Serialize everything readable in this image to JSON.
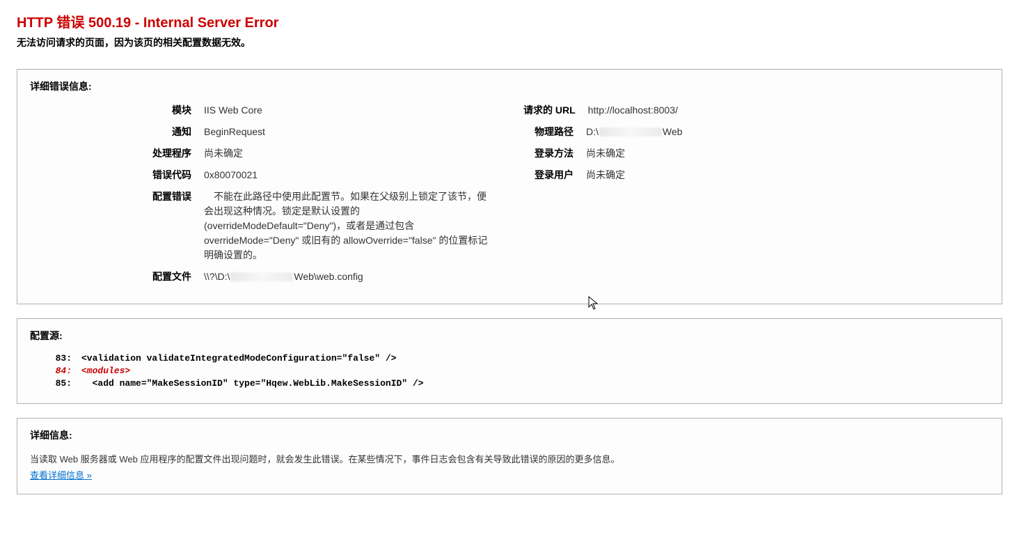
{
  "header": {
    "title": "HTTP 错误 500.19 - Internal Server Error",
    "subtitle": "无法访问请求的页面，因为该页的相关配置数据无效。"
  },
  "details": {
    "heading": "详细错误信息:",
    "left": {
      "module_label": "模块",
      "module_value": "IIS Web Core",
      "notification_label": "通知",
      "notification_value": "BeginRequest",
      "handler_label": "处理程序",
      "handler_value": "尚未确定",
      "error_code_label": "错误代码",
      "error_code_value": "0x80070021",
      "config_error_label": "配置错误",
      "config_error_value": "不能在此路径中使用此配置节。如果在父级别上锁定了该节，便会出现这种情况。锁定是默认设置的(overrideModeDefault=\"Deny\")，或者是通过包含 overrideMode=\"Deny\" 或旧有的 allowOverride=\"false\" 的位置标记明确设置的。",
      "config_file_label": "配置文件",
      "config_file_prefix": "\\\\?\\D:\\",
      "config_file_suffix": "Web\\web.config"
    },
    "right": {
      "requested_url_label": "请求的 URL",
      "requested_url_value": "http://localhost:8003/",
      "physical_path_label": "物理路径",
      "physical_path_prefix": "D:\\",
      "physical_path_suffix": "Web",
      "logon_method_label": "登录方法",
      "logon_method_value": "尚未确定",
      "logon_user_label": "登录用户",
      "logon_user_value": "尚未确定"
    }
  },
  "config_source": {
    "heading": "配置源:",
    "lines": [
      {
        "num": "83:",
        "code": "<validation validateIntegratedModeConfiguration=\"false\" />",
        "error": false
      },
      {
        "num": "84:",
        "code": "<modules>",
        "error": true
      },
      {
        "num": "85:",
        "code": "  <add name=\"MakeSessionID\" type=\"Hqew.WebLib.MakeSessionID\" />",
        "error": false
      }
    ]
  },
  "more_info": {
    "heading": "详细信息:",
    "text": "当读取 Web 服务器或 Web 应用程序的配置文件出现问题时，就会发生此错误。在某些情况下，事件日志会包含有关导致此错误的原因的更多信息。",
    "link_label": "查看详细信息 »"
  }
}
